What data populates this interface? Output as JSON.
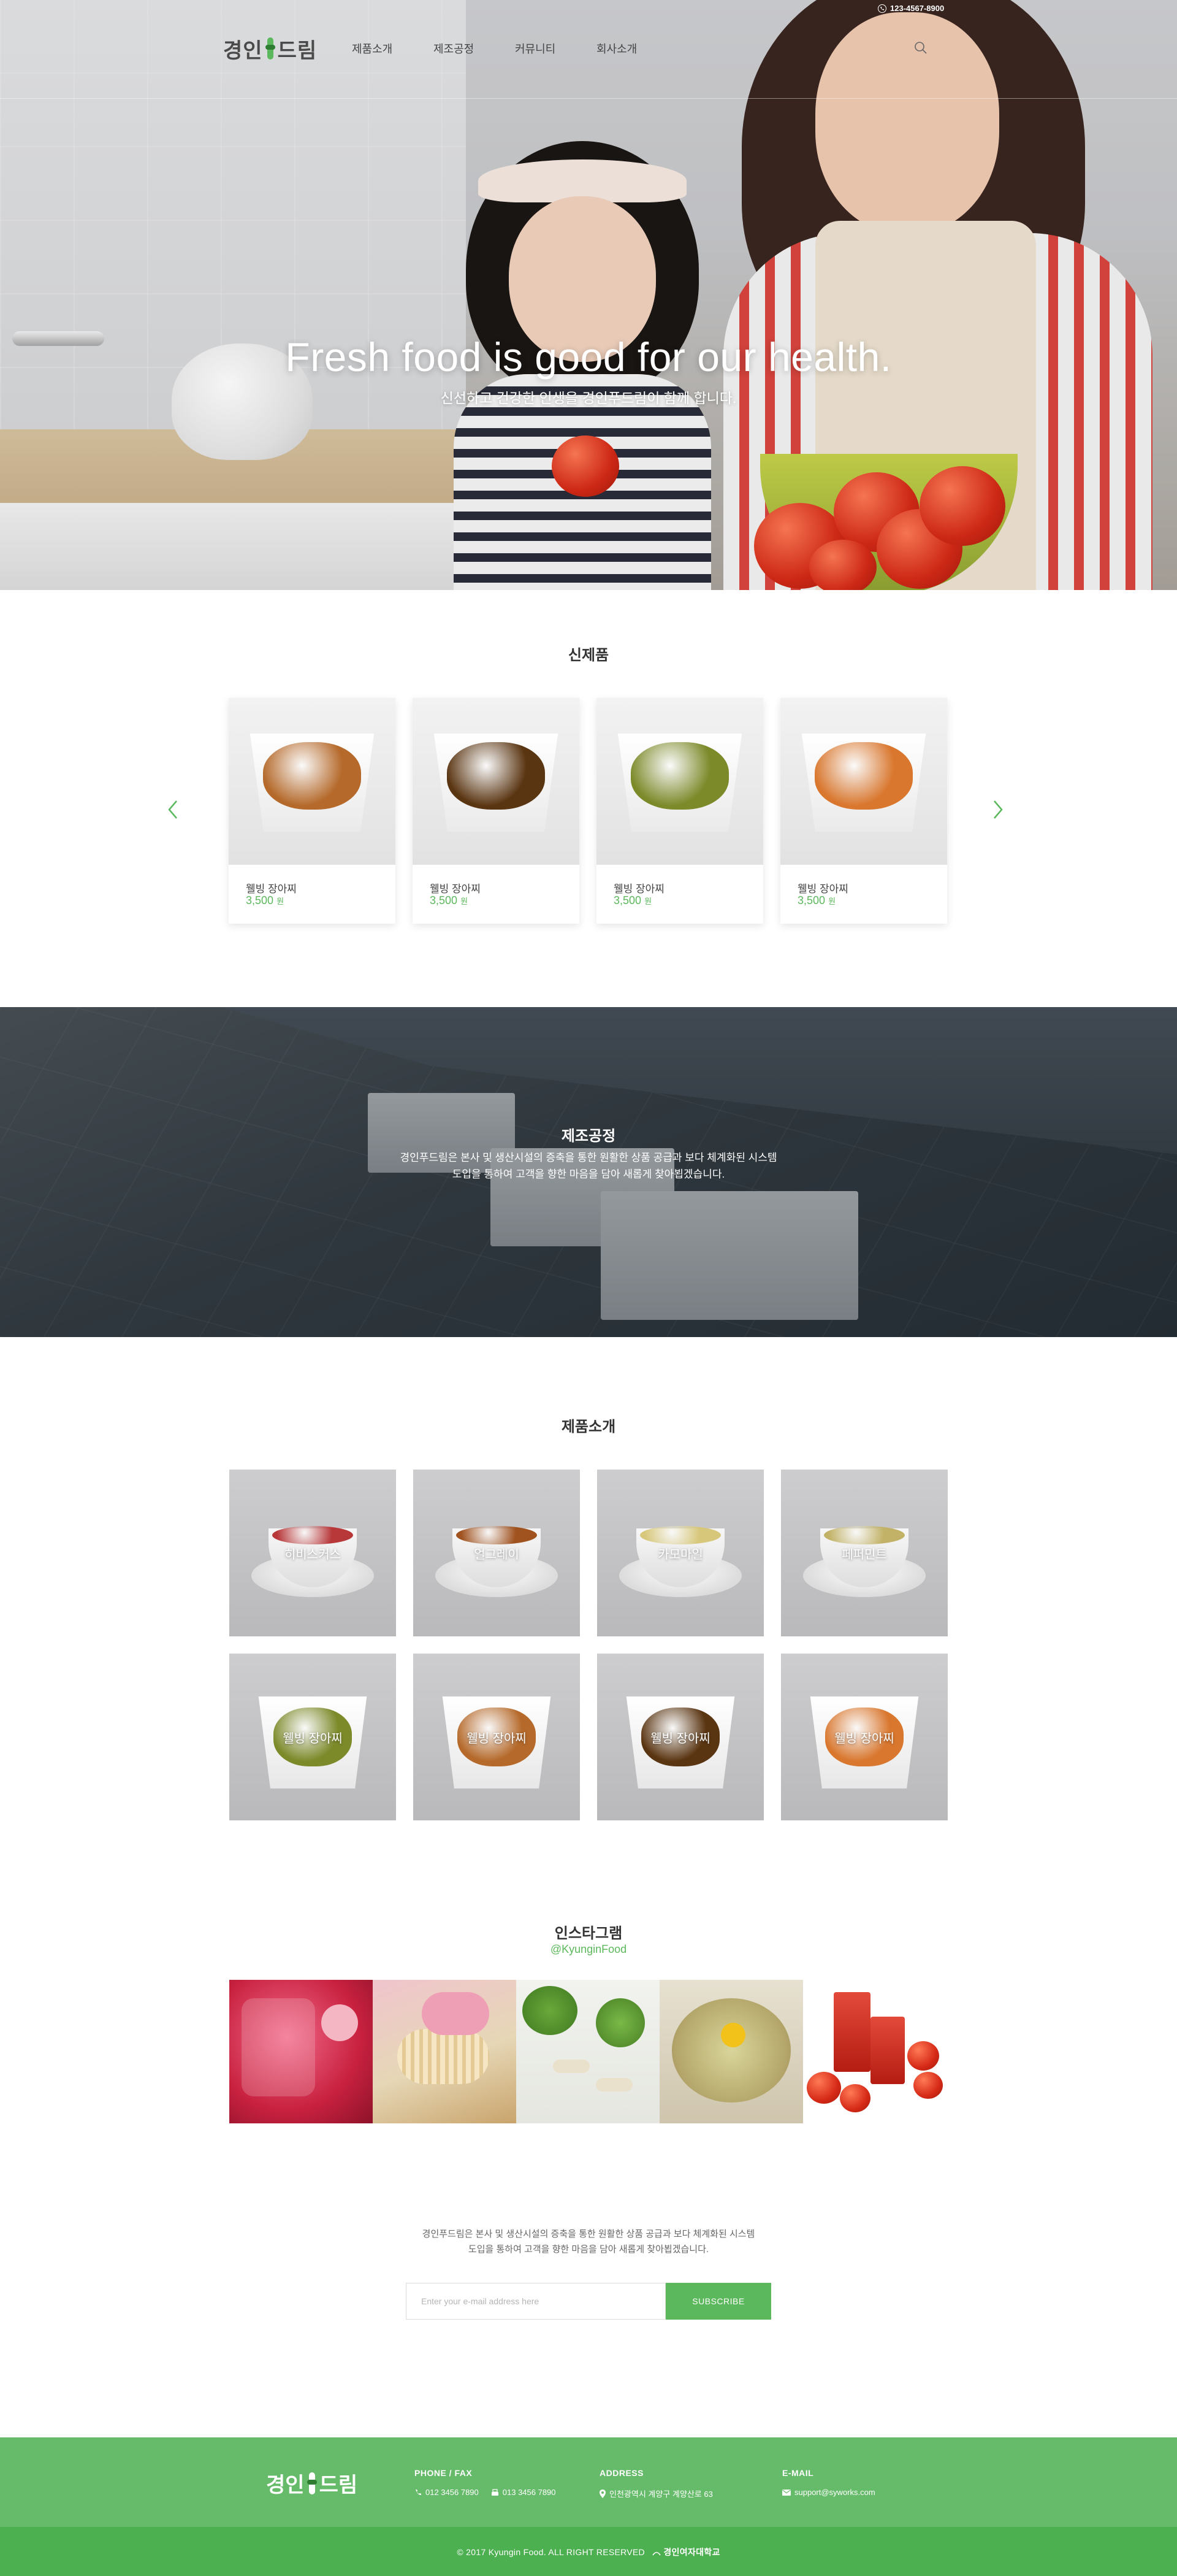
{
  "header": {
    "logo_left": "경인",
    "logo_right": "드림",
    "phone": "123-4567-8900",
    "nav": [
      {
        "label": "제품소개"
      },
      {
        "label": "제조공정"
      },
      {
        "label": "커뮤니티"
      },
      {
        "label": "회사소개"
      }
    ]
  },
  "hero": {
    "title": "Fresh food is good for our health.",
    "subtitle": "신선하고 건강한 인생을 경인푸드림이 함께 합니다."
  },
  "new_products": {
    "title": "신제품",
    "items": [
      {
        "name": "웰빙 장아찌",
        "price": "3,500",
        "unit": "원",
        "food_color": "#b5692a"
      },
      {
        "name": "웰빙 장아찌",
        "price": "3,500",
        "unit": "원",
        "food_color": "#5a3512"
      },
      {
        "name": "웰빙 장아찌",
        "price": "3,500",
        "unit": "원",
        "food_color": "#7d8a2a"
      },
      {
        "name": "웰빙 장아찌",
        "price": "3,500",
        "unit": "원",
        "food_color": "#d9772e"
      }
    ]
  },
  "factory": {
    "title": "제조공정",
    "desc_line1": "경인푸드림은 본사 및 생산시설의 증축을 통한 원활한 상품 공급과 보다 체계화된 시스템",
    "desc_line2": "도입을 통하여 고객을 향한 마음을 담아 새롭게 찾아뵙겠습니다."
  },
  "products": {
    "title": "제품소개",
    "items": [
      {
        "label": "히비스커스",
        "kind": "tea",
        "color": "#b8383a"
      },
      {
        "label": "얼그레이",
        "kind": "tea",
        "color": "#a0521f"
      },
      {
        "label": "카모마일",
        "kind": "tea",
        "color": "#d7c77a"
      },
      {
        "label": "페퍼민트",
        "kind": "tea",
        "color": "#c2b267"
      },
      {
        "label": "웰빙 장아찌",
        "kind": "dish",
        "color": "#7d8a2a"
      },
      {
        "label": "웰빙 장아찌",
        "kind": "dish",
        "color": "#b5692a"
      },
      {
        "label": "웰빙 장아찌",
        "kind": "dish",
        "color": "#5a3512"
      },
      {
        "label": "웰빙 장아찌",
        "kind": "dish",
        "color": "#d9772e"
      }
    ]
  },
  "instagram": {
    "title": "인스타그램",
    "handle": "@KyunginFood"
  },
  "newsletter": {
    "desc_line1": "경인푸드림은 본사 및 생산시설의 증축을 통한 원활한 상품 공급과 보다 체계화된 시스템",
    "desc_line2": "도입을 통하여 고객을 향한 마음을 담아 새롭게 찾아뵙겠습니다.",
    "placeholder": "Enter your e-mail address here",
    "button": "SUBSCRIBE"
  },
  "footer": {
    "logo_left": "경인",
    "logo_right": "드림",
    "phone_fax_label": "PHONE / FAX",
    "phone": "012 3456 7890",
    "fax": "013 3456 7890",
    "address_label": "ADDRESS",
    "address": "인천광역시 계양구 계양산로 63",
    "email_label": "E-MAIL",
    "email": "support@syworks.com",
    "copyright": "© 2017 Kyungin Food. ALL RIGHT RESERVED",
    "school": "경인여자대학교"
  },
  "colors": {
    "accent": "#5cb85c",
    "footer_top": "#66bb6a",
    "footer_bottom": "#4caf50"
  }
}
